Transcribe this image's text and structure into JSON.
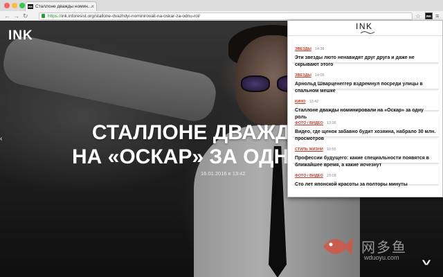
{
  "browser": {
    "tab_title": "Сталлоне дважды номин...",
    "url_https": "https://",
    "url_rest": "ink.inforesist.org/stallone-dvazhdyi-nominirovali-na-oskar-za-odnu-rol/",
    "extension_badge": "INK"
  },
  "page": {
    "logo": "INK",
    "headline_line1": "СТАЛЛОНЕ ДВАЖДЫ НОМ",
    "headline_line2": "НА «ОСКАР» ЗА ОДН",
    "date": "16.01.2016 в 13:42"
  },
  "watermark": {
    "cn": "网多鱼",
    "site": "wduoyu.com"
  },
  "popup": {
    "logo": "INK",
    "items": [
      {
        "category": "Звезды",
        "time": "14:38",
        "title": "Эти звезды люто ненавидят друг друга и даже не скрывают этого"
      },
      {
        "category": "Звезды",
        "time": "14:05",
        "title": "Арнольд Шварценеггер вздремнул посреди улицы в спальном мешке"
      },
      {
        "category": "Кино",
        "time": "13:42",
        "title": "Сталлоне дважды номинировали на «Оскар» за одну роль"
      },
      {
        "category": "Фото / Видео",
        "time": "13:36",
        "title": "Видео, где щенок забавно будит хозяина, набрало 30 млн. просмотров"
      },
      {
        "category": "Стиль жизни",
        "time": "10:55",
        "title": "Профессии будущего: какие специальности появятся в ближайшее время, а какие исчезнут"
      },
      {
        "category": "Фото / Видео",
        "time": "23:08",
        "title": "Сто лет японской красоты за полторы минуты"
      }
    ]
  },
  "colors": {
    "category_red": "#c0392b",
    "secure_green": "#1e8a2e"
  }
}
